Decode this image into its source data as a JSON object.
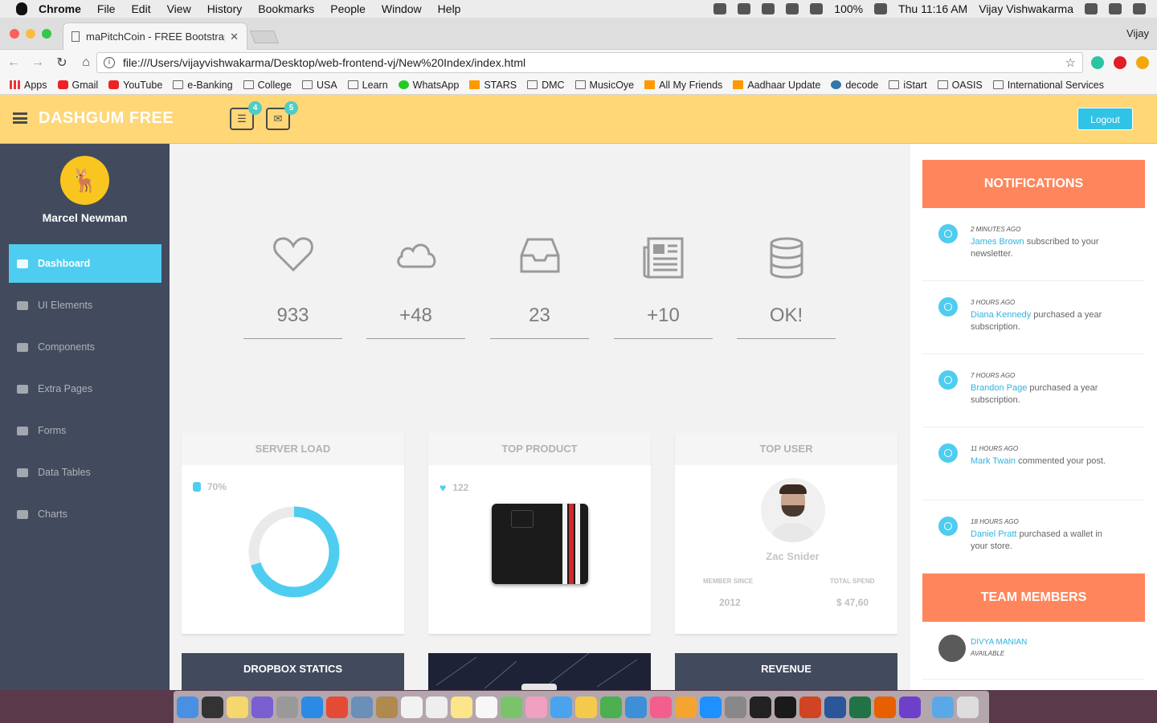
{
  "menubar": {
    "app": "Chrome",
    "items": [
      "File",
      "Edit",
      "View",
      "History",
      "Bookmarks",
      "People",
      "Window",
      "Help"
    ],
    "battery": "100%",
    "clock": "Thu 11:16 AM",
    "user": "Vijay Vishwakarma"
  },
  "browser": {
    "tab_title": "maPitchCoin - FREE Bootstrap",
    "profile_name": "Vijay",
    "url": "file:///Users/vijayvishwakarma/Desktop/web-frontend-vj/New%20Index/index.html",
    "bookmarks": [
      "Apps",
      "Gmail",
      "YouTube",
      "e-Banking",
      "College",
      "USA",
      "Learn",
      "WhatsApp",
      "STARS",
      "DMC",
      "MusicOye",
      "All My Friends",
      "Aadhaar Update",
      "decode",
      "iStart",
      "OASIS",
      "International Services"
    ]
  },
  "header": {
    "logo": "DASHGUM FREE",
    "tasks_badge": "4",
    "mail_badge": "5",
    "logout": "Logout"
  },
  "sidebar": {
    "username": "Marcel Newman",
    "items": [
      {
        "label": "Dashboard",
        "icon": "dashboard-icon"
      },
      {
        "label": "UI Elements",
        "icon": "desktop-icon"
      },
      {
        "label": "Components",
        "icon": "cogs-icon"
      },
      {
        "label": "Extra Pages",
        "icon": "book-icon"
      },
      {
        "label": "Forms",
        "icon": "tasks-icon"
      },
      {
        "label": "Data Tables",
        "icon": "th-icon"
      },
      {
        "label": "Charts",
        "icon": "bar-chart-icon"
      }
    ]
  },
  "stats": [
    {
      "value": "933",
      "icon": "heart-icon"
    },
    {
      "value": "+48",
      "icon": "cloud-icon"
    },
    {
      "value": "23",
      "icon": "inbox-icon"
    },
    {
      "value": "+10",
      "icon": "newspaper-icon"
    },
    {
      "value": "OK!",
      "icon": "database-icon"
    }
  ],
  "panels": {
    "server_load": {
      "title": "SERVER LOAD",
      "value": "70%",
      "fraction": 0.7,
      "color": "#4ecdf0"
    },
    "top_product": {
      "title": "TOP PRODUCT",
      "likes": "122"
    },
    "top_user": {
      "title": "TOP USER",
      "name": "Zac Snider",
      "member_since_label": "MEMBER SINCE",
      "member_since": "2012",
      "total_spend_label": "TOTAL SPEND",
      "total_spend": "$ 47,60"
    },
    "dropbox": {
      "title": "DROPBOX STATICS"
    },
    "revenue": {
      "title": "REVENUE"
    }
  },
  "notifications": {
    "title": "NOTIFICATIONS",
    "items": [
      {
        "time": "2 MINUTES AGO",
        "who": "James Brown",
        "text": " subscribed to your newsletter."
      },
      {
        "time": "3 HOURS AGO",
        "who": "Diana Kennedy",
        "text": " purchased a year subscription."
      },
      {
        "time": "7 HOURS AGO",
        "who": "Brandon Page",
        "text": " purchased a year subscription."
      },
      {
        "time": "11 HOURS AGO",
        "who": "Mark Twain",
        "text": " commented your post."
      },
      {
        "time": "18 HOURS AGO",
        "who": "Daniel Pratt",
        "text": " purchased a wallet in your store."
      }
    ]
  },
  "team": {
    "title": "TEAM MEMBERS",
    "members": [
      {
        "name": "DIVYA MANIAN",
        "status": "AVAILABLE"
      }
    ]
  },
  "colors": {
    "accent": "#4ecdf0",
    "header": "#ffd777",
    "orange": "#ff865c",
    "sidebar": "#424a5d"
  }
}
